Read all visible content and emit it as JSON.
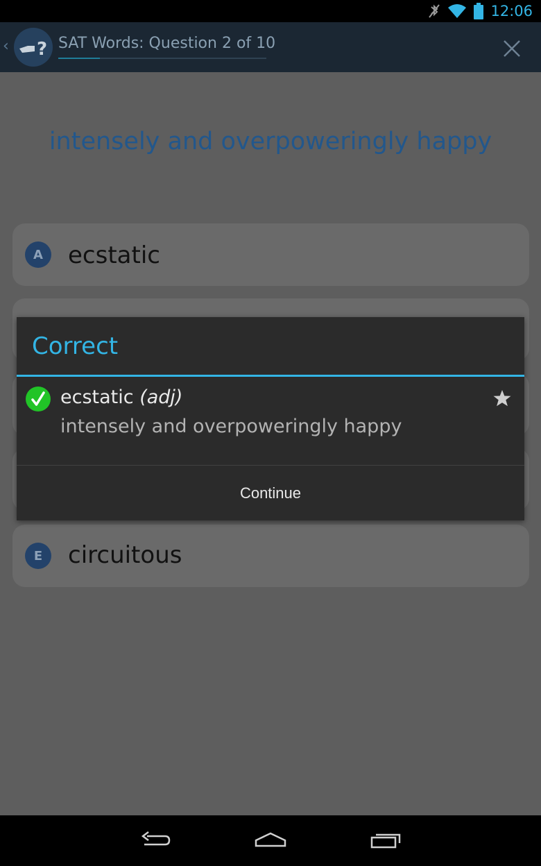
{
  "status_bar": {
    "time": "12:06",
    "icons": [
      "bluetooth-muted-icon",
      "wifi-icon",
      "battery-icon"
    ]
  },
  "action_bar": {
    "title": "SAT Words: Question 2 of 10",
    "progress": 0.2,
    "icons": [
      "back-caret-icon",
      "app-logo-icon",
      "close-icon"
    ]
  },
  "question": {
    "prompt": "intensely and overpoweringly happy"
  },
  "answers": [
    {
      "letter": "A",
      "text": "ecstatic"
    },
    {
      "letter": "E",
      "text": "circuitous"
    }
  ],
  "dialog": {
    "title": "Correct",
    "word": "ecstatic",
    "part_of_speech": "(adj)",
    "definition": "intensely and overpoweringly happy",
    "button_label": "Continue",
    "icons": [
      "check-icon",
      "star-icon"
    ]
  },
  "nav_bar": {
    "icons": [
      "back-icon",
      "home-icon",
      "recents-icon"
    ]
  },
  "colors": {
    "accent": "#33b5e5",
    "success": "#21c427",
    "action_bar": "#1b2733"
  }
}
